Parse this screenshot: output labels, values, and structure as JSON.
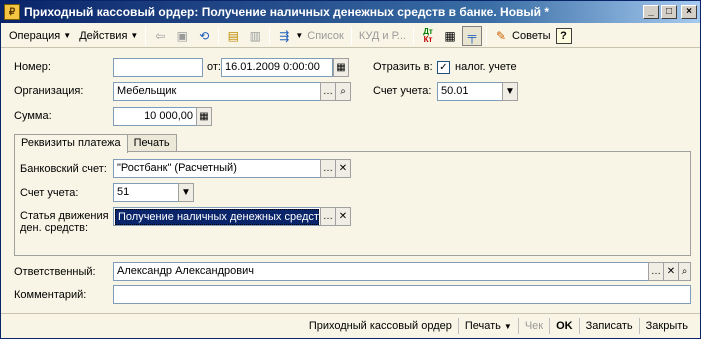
{
  "window": {
    "title": "Приходный кассовый ордер: Получение наличных денежных средств в банке. Новый *",
    "buttons": {
      "minimize": "_",
      "maximize": "□",
      "close": "×"
    }
  },
  "toolbar": {
    "operation": "Операция",
    "actions": "Действия",
    "list": "Список",
    "kud": "КУД и Р...",
    "dt_kt": "Дт Кт",
    "tips": "Советы",
    "help": "?"
  },
  "form": {
    "number_label": "Номер:",
    "number_value": "",
    "from_label": "от:",
    "date_value": "16.01.2009  0:00:00",
    "reflect_label": "Отразить в:",
    "tax_label": "налог. учете",
    "tax_checked": true,
    "org_label": "Организация:",
    "org_value": "Мебельщик",
    "account_label": "Счет учета:",
    "account_value": "50.01",
    "sum_label": "Сумма:",
    "sum_value": "10 000,00"
  },
  "tabs": [
    {
      "label": "Реквизиты платежа",
      "active": true
    },
    {
      "label": "Печать",
      "active": false
    }
  ],
  "payment": {
    "bank_label": "Банковский счет:",
    "bank_value": "\"Ростбанк\" (Расчетный)",
    "account_label": "Счет учета:",
    "account_value": "51",
    "cashflow_label_1": "Статья движения",
    "cashflow_label_2": "ден. средств:",
    "cashflow_value": "Получение наличных денежных средств"
  },
  "responsible": {
    "label": "Ответственный:",
    "value": "Александр Александрович"
  },
  "comment": {
    "label": "Комментарий:",
    "value": ""
  },
  "footer": {
    "receipt": "Приходный кассовый ордер",
    "print": "Печать",
    "check": "Чек",
    "ok": "OK",
    "save": "Записать",
    "close": "Закрыть"
  }
}
